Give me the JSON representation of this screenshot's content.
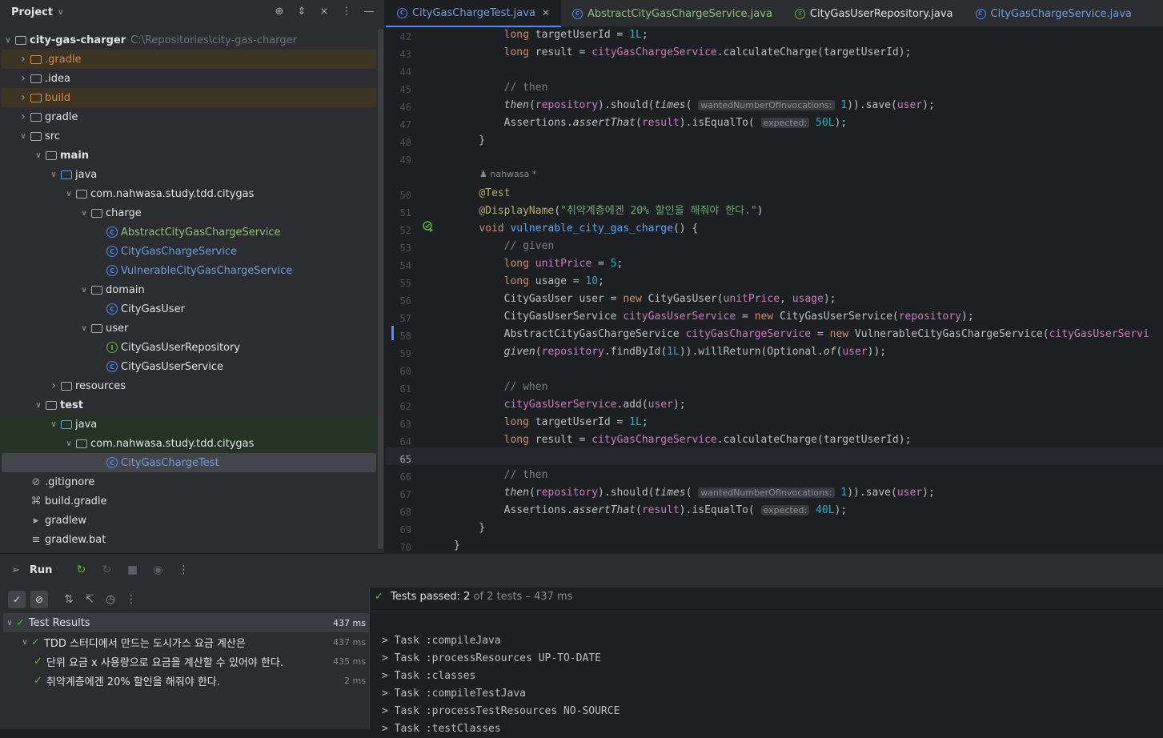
{
  "project_panel": {
    "title": "Project",
    "tree": [
      {
        "label": "city-gas-charger",
        "hint": "C:\\Repositories\\city-gas-charger",
        "level": 0,
        "expanded": true,
        "icon": "module-folder-icon",
        "style": "default",
        "highlight": "none"
      },
      {
        "label": ".gradle",
        "level": 1,
        "expanded": false,
        "icon": "folder-icon",
        "style": "orange",
        "highlight": "orange"
      },
      {
        "label": ".idea",
        "level": 1,
        "expanded": false,
        "icon": "folder-icon",
        "style": "default",
        "highlight": "none"
      },
      {
        "label": "build",
        "level": 1,
        "expanded": false,
        "icon": "folder-icon",
        "style": "orange",
        "highlight": "orange"
      },
      {
        "label": "gradle",
        "level": 1,
        "expanded": false,
        "icon": "folder-icon",
        "style": "default",
        "highlight": "none"
      },
      {
        "label": "src",
        "level": 1,
        "expanded": true,
        "icon": "folder-icon",
        "style": "default",
        "highlight": "none"
      },
      {
        "label": "main",
        "level": 2,
        "expanded": true,
        "icon": "source-folder-icon",
        "style": "default",
        "highlight": "none"
      },
      {
        "label": "java",
        "level": 3,
        "expanded": true,
        "icon": "blue-folder-icon",
        "style": "default",
        "highlight": "none"
      },
      {
        "label": "com.nahwasa.study.tdd.citygas",
        "level": 4,
        "expanded": true,
        "icon": "package-icon",
        "style": "default",
        "highlight": "none"
      },
      {
        "label": "charge",
        "level": 5,
        "expanded": true,
        "icon": "package-icon",
        "style": "default",
        "highlight": "none"
      },
      {
        "label": "AbstractCityGasChargeService",
        "level": 6,
        "icon": "class-icon",
        "style": "green",
        "highlight": "none"
      },
      {
        "label": "CityGasChargeService",
        "level": 6,
        "icon": "class-icon",
        "style": "blue",
        "highlight": "none"
      },
      {
        "label": "VulnerableCityGasChargeService",
        "level": 6,
        "icon": "class-icon",
        "style": "blue",
        "highlight": "none"
      },
      {
        "label": "domain",
        "level": 5,
        "expanded": true,
        "icon": "package-icon",
        "style": "default",
        "highlight": "none"
      },
      {
        "label": "CityGasUser",
        "level": 6,
        "icon": "class-icon",
        "style": "default",
        "highlight": "none"
      },
      {
        "label": "user",
        "level": 5,
        "expanded": true,
        "icon": "package-icon",
        "style": "default",
        "highlight": "none"
      },
      {
        "label": "CityGasUserRepository",
        "level": 6,
        "icon": "interface-icon",
        "style": "default",
        "highlight": "none"
      },
      {
        "label": "CityGasUserService",
        "level": 6,
        "icon": "class-icon",
        "style": "default",
        "highlight": "none"
      },
      {
        "label": "resources",
        "level": 3,
        "expanded": false,
        "icon": "resources-folder-icon",
        "style": "default",
        "highlight": "none"
      },
      {
        "label": "test",
        "level": 2,
        "expanded": true,
        "icon": "source-folder-icon",
        "style": "default",
        "highlight": "none"
      },
      {
        "label": "java",
        "level": 3,
        "expanded": true,
        "icon": "green-folder-icon",
        "style": "default",
        "highlight": "green"
      },
      {
        "label": "com.nahwasa.study.tdd.citygas",
        "level": 4,
        "expanded": true,
        "icon": "package-icon",
        "style": "default",
        "highlight": "green"
      },
      {
        "label": "CityGasChargeTest",
        "level": 6,
        "icon": "class-icon",
        "style": "blue",
        "highlight": "selected"
      },
      {
        "label": ".gitignore",
        "level": 1,
        "icon": "ignore-file-icon",
        "style": "default",
        "highlight": "none"
      },
      {
        "label": "build.gradle",
        "level": 1,
        "icon": "gradle-icon",
        "style": "default",
        "highlight": "none"
      },
      {
        "label": "gradlew",
        "level": 1,
        "icon": "shell-file-icon",
        "style": "default",
        "highlight": "none"
      },
      {
        "label": "gradlew.bat",
        "level": 1,
        "icon": "text-file-icon",
        "style": "default",
        "highlight": "none"
      }
    ]
  },
  "tabs": [
    {
      "label": "CityGasChargeTest.java",
      "active": true,
      "kind": "class",
      "color": "#6e9fd9"
    },
    {
      "label": "AbstractCityGasChargeService.java",
      "active": false,
      "kind": "class",
      "color": "#8ec07c"
    },
    {
      "label": "CityGasUserRepository.java",
      "active": false,
      "kind": "interface",
      "color": "#dfe1e5"
    },
    {
      "label": "CityGasChargeService.java",
      "active": false,
      "kind": "class",
      "color": "#6e9fd9"
    }
  ],
  "editor": {
    "author": "nahwasa *",
    "current_line": "65",
    "lines": [
      {
        "n": "42",
        "html": "        <span class='kw'>long</span> <span class='pl'>targetUserId</span> = <span class='num'>1L</span>;"
      },
      {
        "n": "43",
        "html": "        <span class='kw'>long</span> <span class='pl'>result</span> = <span class='var'>cityGasChargeService</span>.calculateCharge(targetUserId);"
      },
      {
        "n": "44",
        "html": ""
      },
      {
        "n": "45",
        "html": "        <span class='cm'>// then</span>"
      },
      {
        "n": "46",
        "html": "        <span class='it'>then</span>(<span class='var'>repository</span>).should(<span class='it'>times</span>( <span class='hint-in'>wantedNumberOfInvocations:</span> <span class='num'>1</span>)).save(<span class='var'>user</span>);"
      },
      {
        "n": "47",
        "html": "        Assertions.<span class='it'>assertThat</span>(<span class='var'>result</span>).isEqualTo( <span class='hint-in'>expected:</span> <span class='num'>50L</span>);"
      },
      {
        "n": "48",
        "html": "    }"
      },
      {
        "n": "49",
        "html": ""
      },
      {
        "n": "50",
        "html": "    <span class='ann'>@Test</span>"
      },
      {
        "n": "51",
        "html": "    <span class='ann'>@DisplayName</span>(<span class='str'>\"취약계층에겐 20% 할인을 해줘야 한다.\"</span>)"
      },
      {
        "n": "52",
        "html": "    <span class='kw'>void</span> <span class='fn'>vulnerable_city_gas_charge</span>() {"
      },
      {
        "n": "53",
        "html": "        <span class='cm'>// given</span>"
      },
      {
        "n": "54",
        "html": "        <span class='kw'>long</span> <span class='var'>unitPrice</span> = <span class='num'>5</span>;"
      },
      {
        "n": "55",
        "html": "        <span class='kw'>long</span> <span class='pl'>usage</span> = <span class='num'>10</span>;"
      },
      {
        "n": "56",
        "html": "        CityGasUser <span class='pl'>user</span> = <span class='kw'>new</span> CityGasUser(<span class='var'>unitPrice</span>, <span class='var'>usage</span>);"
      },
      {
        "n": "57",
        "html": "        CityGasUserService <span class='var'>cityGasUserService</span> = <span class='kw'>new</span> CityGasUserService(<span class='var'>repository</span>);"
      },
      {
        "n": "58",
        "html": "        AbstractCityGasChargeService <span class='var'>cityGasChargeService</span> = <span class='kw'>new</span> VulnerableCityGasChargeService(<span class='var'>cityGasUserServi</span>"
      },
      {
        "n": "59",
        "html": "        <span class='it'>given</span>(<span class='var'>repository</span>.findById(<span class='num'>1L</span>)).willReturn(Optional.<span class='it'>of</span>(<span class='var'>user</span>));"
      },
      {
        "n": "60",
        "html": ""
      },
      {
        "n": "61",
        "html": "        <span class='cm'>// when</span>"
      },
      {
        "n": "62",
        "html": "        <span class='var'>cityGasUserService</span>.add(<span class='var'>user</span>);"
      },
      {
        "n": "63",
        "html": "        <span class='kw'>long</span> <span class='pl'>targetUserId</span> = <span class='num'>1L</span>;"
      },
      {
        "n": "64",
        "html": "        <span class='kw'>long</span> <span class='pl'>result</span> = <span class='var'>cityGasChargeService</span>.calculateCharge(targetUserId);"
      },
      {
        "n": "65",
        "html": ""
      },
      {
        "n": "66",
        "html": "        <span class='cm'>// then</span>"
      },
      {
        "n": "67",
        "html": "        <span class='it'>then</span>(<span class='var'>repository</span>).should(<span class='it'>times</span>( <span class='hint-in'>wantedNumberOfInvocations:</span> <span class='num'>1</span>)).save(<span class='var'>user</span>);"
      },
      {
        "n": "68",
        "html": "        Assertions.<span class='it'>assertThat</span>(<span class='var'>result</span>).isEqualTo( <span class='hint-in'>expected:</span> <span class='num'>40L</span>);"
      },
      {
        "n": "69",
        "html": "    }"
      },
      {
        "n": "70",
        "html": "}"
      }
    ]
  },
  "run_panel": {
    "title": "Run",
    "status_passed": "Tests passed: ",
    "status_count": "2",
    "status_rest": " of 2 tests – 437 ms",
    "tests": [
      {
        "label": "Test Results",
        "time": "437 ms",
        "level": 0,
        "selected": true
      },
      {
        "label": "TDD 스터디에서 만드는 도시가스 요금 계산은",
        "time": "437 ms",
        "level": 1,
        "selected": false
      },
      {
        "label": "단위 요금 x 사용량으로 요금을 계산할 수 있어야 한다.",
        "time": "435 ms",
        "level": 2,
        "selected": false
      },
      {
        "label": "취약계층에겐 20% 할인을 해줘야 한다.",
        "time": "2 ms",
        "level": 2,
        "selected": false
      }
    ],
    "console": [
      "> Task :compileJava",
      "> Task :processResources UP-TO-DATE",
      "> Task :classes",
      "> Task :compileTestJava",
      "> Task :processTestResources NO-SOURCE",
      "> Task :testClasses"
    ]
  }
}
